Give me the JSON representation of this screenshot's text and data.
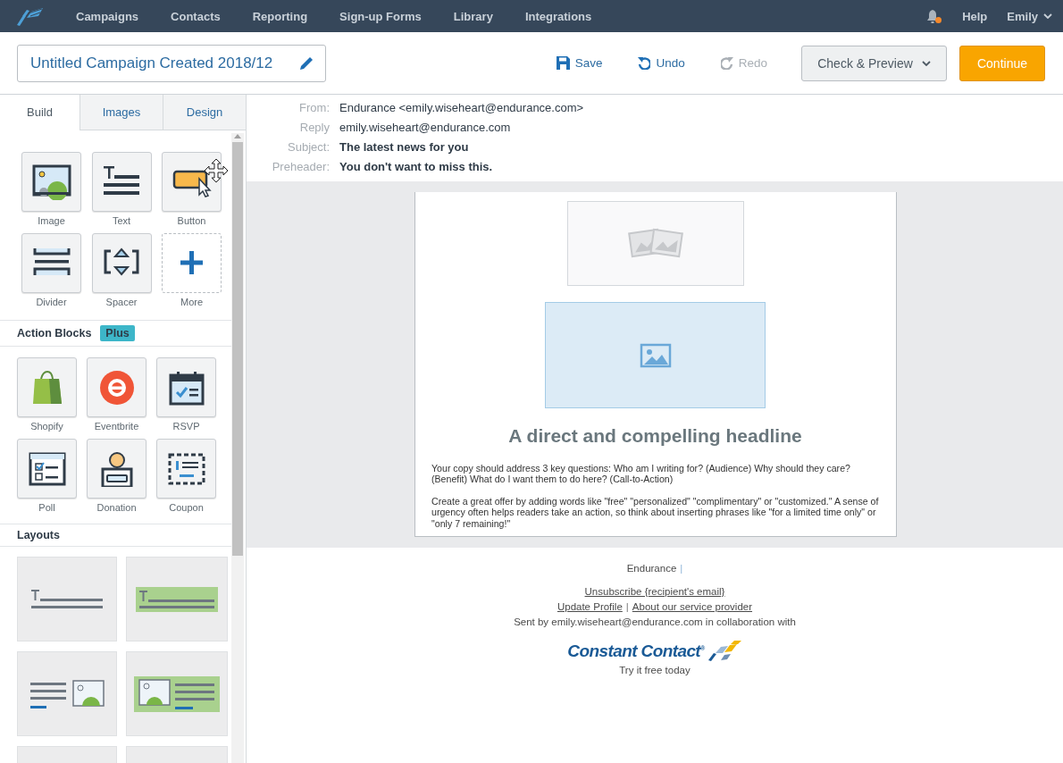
{
  "nav": {
    "items": [
      "Campaigns",
      "Contacts",
      "Reporting",
      "Sign-up Forms",
      "Library",
      "Integrations"
    ],
    "notification_dot": true,
    "help": "Help",
    "user": "Emily"
  },
  "toolbar": {
    "title_field": "Untitled Campaign Created 2018/12",
    "save": "Save",
    "undo": "Undo",
    "redo": {
      "label": "Redo",
      "disabled": true
    },
    "check_preview": "Check & Preview",
    "continue": "Continue"
  },
  "sidebar": {
    "tabs": [
      {
        "label": "Build",
        "selected": true
      },
      {
        "label": "Images",
        "selected": false
      },
      {
        "label": "Design",
        "selected": false
      }
    ],
    "blocks": [
      {
        "label": "Image",
        "kind": "image"
      },
      {
        "label": "Text",
        "kind": "text"
      },
      {
        "label": "Button",
        "kind": "button"
      },
      {
        "label": "Divider",
        "kind": "divider"
      },
      {
        "label": "Spacer",
        "kind": "spacer"
      },
      {
        "label": "More",
        "kind": "more"
      }
    ],
    "action_blocks": {
      "title": "Action Blocks",
      "badge": "Plus",
      "items": [
        {
          "label": "Shopify",
          "kind": "bag"
        },
        {
          "label": "Eventbrite",
          "kind": "ring"
        },
        {
          "label": "RSVP",
          "kind": "calendar"
        },
        {
          "label": "Poll",
          "kind": "checklist"
        },
        {
          "label": "Donation",
          "kind": "coinbox"
        },
        {
          "label": "Coupon",
          "kind": "coupon"
        }
      ]
    },
    "layouts": {
      "title": "Layouts",
      "items": [
        {
          "kind": "text"
        },
        {
          "kind": "text_band"
        },
        {
          "kind": "image_text"
        },
        {
          "kind": "image_text_band"
        },
        {
          "kind": "blank"
        },
        {
          "kind": "blank"
        }
      ]
    }
  },
  "email": {
    "header": [
      {
        "label": "From:",
        "value": "Endurance <emily.wiseheart@endurance.com>",
        "bold": false
      },
      {
        "label": "Reply",
        "value": "emily.wiseheart@endurance.com",
        "bold": false
      },
      {
        "label": "Subject:",
        "value": "The latest news for you",
        "bold": true
      },
      {
        "label": "Preheader:",
        "value": "You don't want to miss this.",
        "bold": true
      }
    ],
    "image_blocks": [
      {
        "selected": false
      },
      {
        "selected": true
      }
    ],
    "headline": "A direct and compelling headline",
    "paragraphs": [
      "Your copy should address 3 key questions: Who am I writing for? (Audience) Why should they care? (Benefit) What do I want them to do here? (Call-to-Action)",
      "Create a great offer by adding words like \"free\" \"personalized\" \"complimentary\" or \"customized.\" A sense of urgency often helps readers take an action, so think about inserting phrases like \"for a limited time only\" or \"only 7 remaining!\""
    ],
    "footer": {
      "company": "Endurance",
      "company_separator": "|",
      "unsubscribe": "Unsubscribe {recipient's email}",
      "update_profile": "Update Profile",
      "link_separator": "|",
      "about": "About our service provider",
      "sent_by": "Sent by emily.wiseheart@endurance.com in collaboration with",
      "logo": "Constant Contact$^{®}$",
      "tagline": "Try it free today"
    }
  }
}
